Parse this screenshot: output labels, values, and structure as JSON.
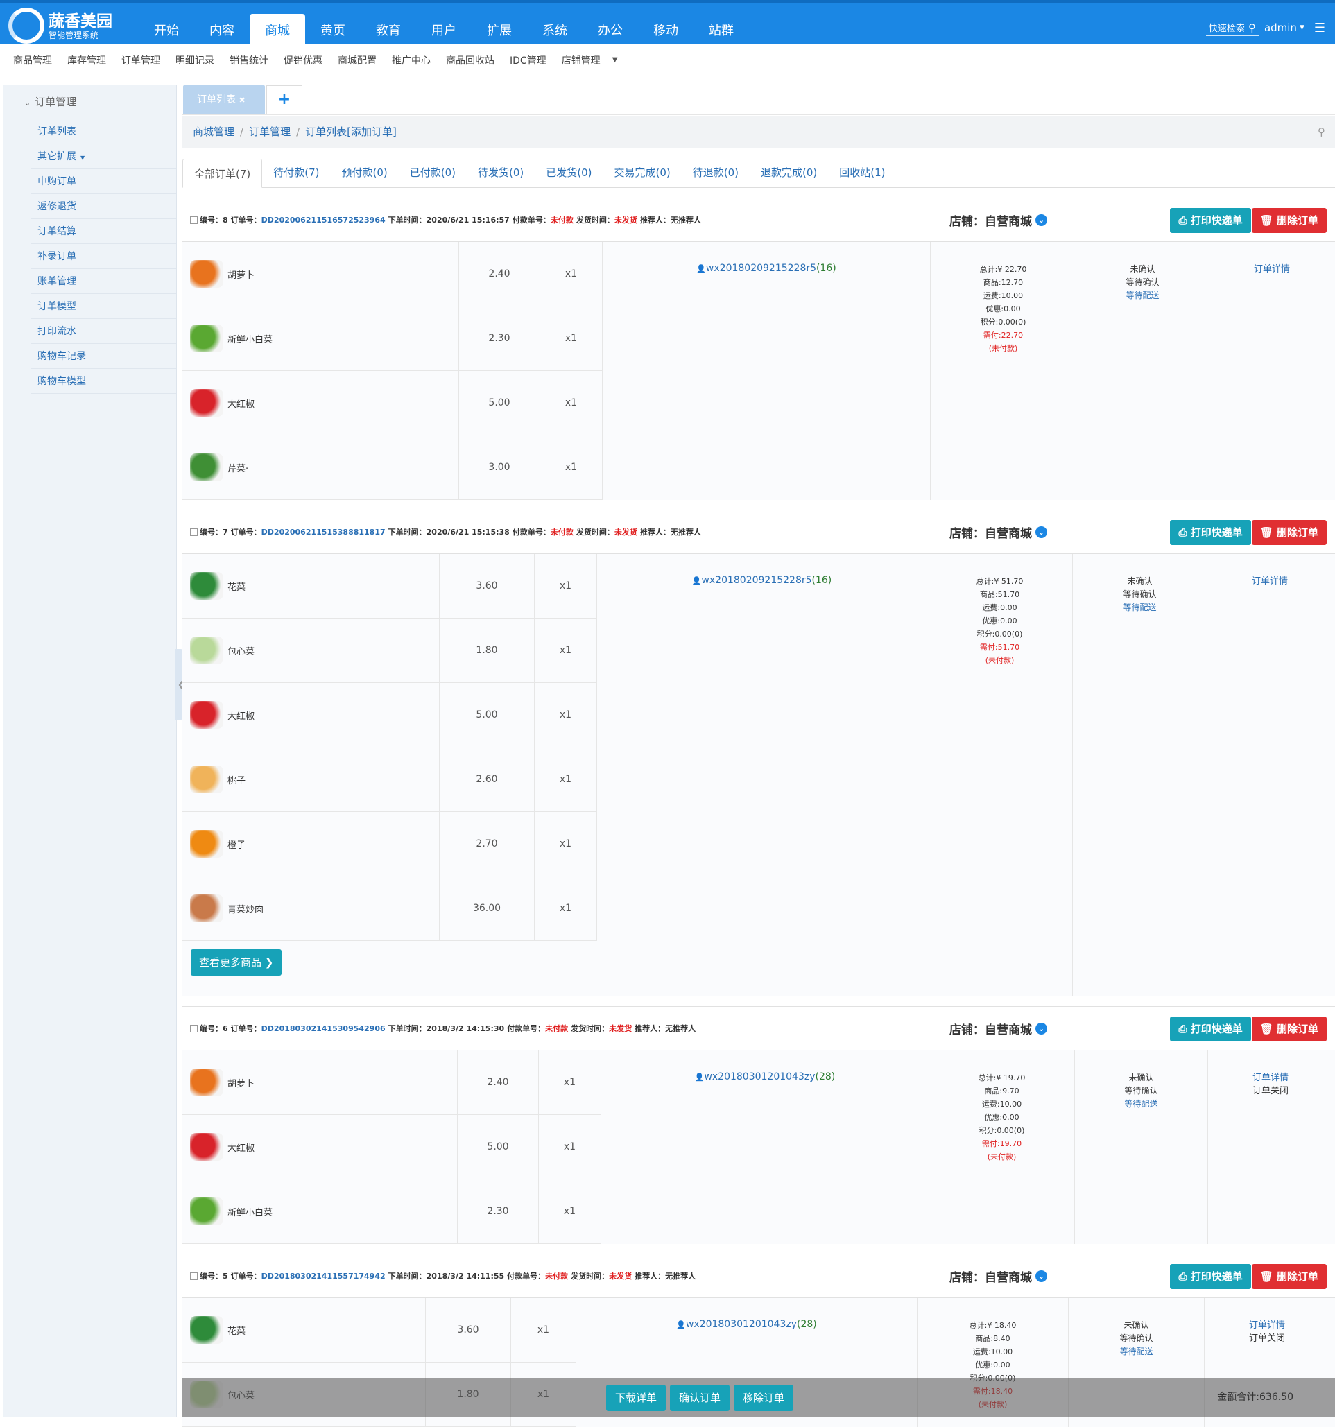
{
  "app": {
    "name": "蔬香美园",
    "subtitle": "智能管理系统",
    "user": "admin",
    "quick_search": "快速检索"
  },
  "topnav": [
    "开始",
    "内容",
    "商城",
    "黄页",
    "教育",
    "用户",
    "扩展",
    "系统",
    "办公",
    "移动",
    "站群"
  ],
  "subnav": [
    "商品管理",
    "库存管理",
    "订单管理",
    "明细记录",
    "销售统计",
    "促销优惠",
    "商城配置",
    "推广中心",
    "商品回收站",
    "IDC管理",
    "店铺管理"
  ],
  "sidebar": {
    "header": "订单管理",
    "items": [
      "订单列表",
      "其它扩展",
      "申购订单",
      "返修退货",
      "订单结算",
      "补录订单",
      "账单管理",
      "订单模型",
      "打印流水",
      "购物车记录",
      "购物车模型"
    ]
  },
  "tab": {
    "label": "订单列表",
    "close": "✖",
    "plus": "+"
  },
  "breadcrumb": {
    "a": "商城管理",
    "b": "订单管理",
    "c": "订单列表",
    "d": "[添加订单]"
  },
  "order_tabs": [
    "全部订单(7)",
    "待付款(7)",
    "预付款(0)",
    "已付款(0)",
    "待发货(0)",
    "已发货(0)",
    "交易完成(0)",
    "待退款(0)",
    "退款完成(0)",
    "回收站(1)"
  ],
  "labels": {
    "no": "编号：",
    "order_no": "订单号：",
    "order_time": "下单时间：",
    "pay_no": "付款单号：",
    "unpaid": "未付款",
    "ship_time": "发货时间：",
    "not_shipped": "未发货",
    "referrer": "推荐人：",
    "no_referrer": "无推荐人",
    "shop_label": "店铺：",
    "shop": "自营商城",
    "print": "打印快递单",
    "delete": "删除订单",
    "detail": "订单详情",
    "closed": "订单关闭",
    "more": "查看更多商品",
    "unconfirmed": "未确认",
    "wait_confirm": "等待确认",
    "wait_deliver": "等待配送"
  },
  "orders": [
    {
      "id": "8",
      "order_no": "DD20200621151657252396​4",
      "time": "2020/6/21 15:16:57",
      "buyer": "wx20180209215228r5",
      "buyer_id": "(16)",
      "total": "总计:¥ 22.70",
      "goods": "商品:12.70",
      "freight": "运费:10.00",
      "discount": "优惠:0.00",
      "points": "积分:0.00(0)",
      "need": "需付:22.70",
      "pay_state": "(未付款)",
      "items": [
        {
          "name": "胡萝卜",
          "price": "2.40",
          "qty": "x1",
          "color": "#e8731e"
        },
        {
          "name": "新鲜小白菜",
          "price": "2.30",
          "qty": "x1",
          "color": "#5aa832"
        },
        {
          "name": "大红椒",
          "price": "5.00",
          "qty": "x1",
          "color": "#d8232a"
        },
        {
          "name": "芹菜·",
          "price": "3.00",
          "qty": "x1",
          "color": "#3f8f35"
        }
      ]
    },
    {
      "id": "7",
      "order_no": "DD20200621151538881181​7",
      "time": "2020/6/21 15:15:38",
      "buyer": "wx20180209215228r5",
      "buyer_id": "(16)",
      "total": "总计:¥ 51.70",
      "goods": "商品:51.70",
      "freight": "运费:0.00",
      "discount": "优惠:0.00",
      "points": "积分:0.00(0)",
      "need": "需付:51.70",
      "pay_state": "(未付款)",
      "items": [
        {
          "name": "花菜",
          "price": "3.60",
          "qty": "x1",
          "color": "#2e8b3a"
        },
        {
          "name": "包心菜",
          "price": "1.80",
          "qty": "x1",
          "color": "#b9d99a"
        },
        {
          "name": "大红椒",
          "price": "5.00",
          "qty": "x1",
          "color": "#d8232a"
        },
        {
          "name": "桃子",
          "price": "2.60",
          "qty": "x1",
          "color": "#f0b35a"
        },
        {
          "name": "橙子",
          "price": "2.70",
          "qty": "x1",
          "color": "#ef8a12"
        },
        {
          "name": "青菜炒肉",
          "price": "36.00",
          "qty": "x1",
          "color": "#c97a4a"
        }
      ]
    },
    {
      "id": "6",
      "order_no": "DD20180302141530954290​6",
      "time": "2018/3/2 14:15:30",
      "buyer": "wx20180301201043zy",
      "buyer_id": "(28)",
      "total": "总计:¥ 19.70",
      "goods": "商品:9.70",
      "freight": "运费:10.00",
      "discount": "优惠:0.00",
      "points": "积分:0.00(0)",
      "need": "需付:19.70",
      "pay_state": "(未付款)",
      "closed": true,
      "items": [
        {
          "name": "胡萝卜",
          "price": "2.40",
          "qty": "x1",
          "color": "#e8731e"
        },
        {
          "name": "大红椒",
          "price": "5.00",
          "qty": "x1",
          "color": "#d8232a"
        },
        {
          "name": "新鲜小白菜",
          "price": "2.30",
          "qty": "x1",
          "color": "#5aa832"
        }
      ]
    },
    {
      "id": "5",
      "order_no": "DD20180302141155717494​2",
      "time": "2018/3/2 14:11:55",
      "buyer": "wx20180301201043zy",
      "buyer_id": "(28)",
      "total": "总计:¥ 18.40",
      "goods": "商品:8.40",
      "freight": "运费:10.00",
      "discount": "优惠:0.00",
      "points": "积分:0.00(0)",
      "need": "需付:18.40",
      "pay_state": "(未付款)",
      "closed": true,
      "items": [
        {
          "name": "花菜",
          "price": "3.60",
          "qty": "x1",
          "color": "#2e8b3a"
        },
        {
          "name": "包心菜",
          "price": "1.80",
          "qty": "x1",
          "color": "#b9d99a"
        }
      ]
    }
  ],
  "bottom": {
    "download": "下载详单",
    "confirm": "确认订单",
    "remove": "移除订单",
    "total": "金额合计:636.50"
  }
}
